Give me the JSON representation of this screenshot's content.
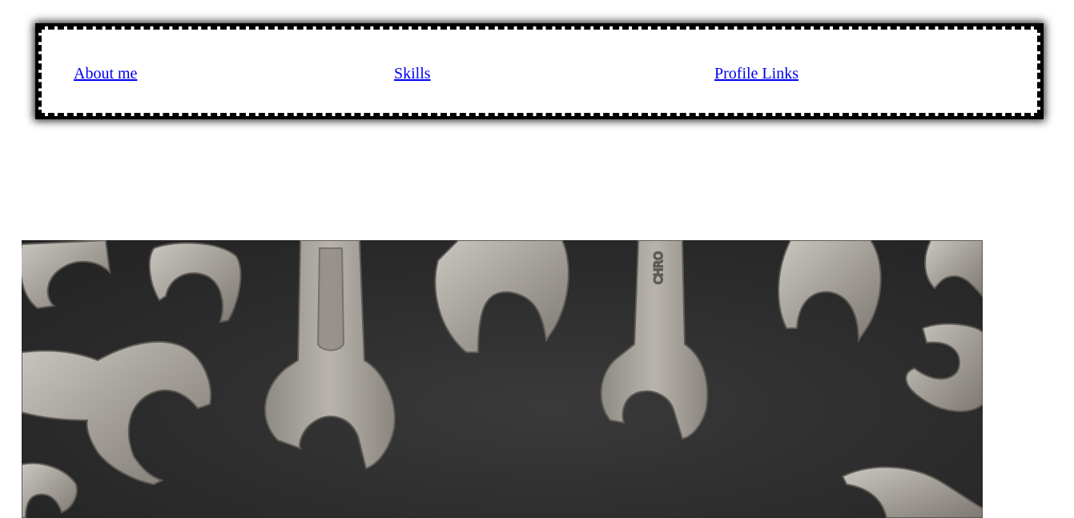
{
  "nav": {
    "items": [
      {
        "label": "About me"
      },
      {
        "label": "Skills"
      },
      {
        "label": "Profile Links"
      }
    ]
  },
  "hero": {
    "image": "wrenches-photo",
    "engraving": "CHRO"
  },
  "colors": {
    "link": "#0000ee",
    "frame_border": "#000000",
    "background": "#ffffff",
    "photo_background": "#2c2c2c",
    "wrench_metal": "#a8a49e"
  }
}
